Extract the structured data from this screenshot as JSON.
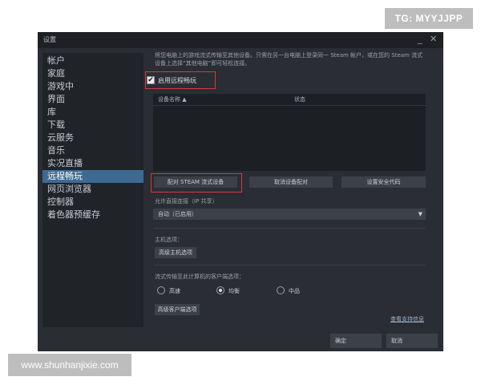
{
  "watermarks": {
    "top": "TG: MYYJJPP",
    "bottom": "www.shunhanjixie.com"
  },
  "window": {
    "title": "设置",
    "minimize": "_",
    "close": "✕"
  },
  "sidebar": {
    "items": [
      {
        "label": "帐户"
      },
      {
        "label": "家庭"
      },
      {
        "label": "游戏中"
      },
      {
        "label": "界面"
      },
      {
        "label": "库"
      },
      {
        "label": "下载"
      },
      {
        "label": "云服务"
      },
      {
        "label": "音乐"
      },
      {
        "label": "实况直播"
      },
      {
        "label": "远程畅玩"
      },
      {
        "label": "网页浏览器"
      },
      {
        "label": "控制器"
      },
      {
        "label": "着色器预缓存"
      }
    ],
    "active_index": 9
  },
  "panel": {
    "description": "将您电脑上的游戏流式传输至其他设备。只需在另一台电脑上登录同一 Steam 帐户，或在您的 Steam 流式设备上选择“其他电脑”即可轻松连接。",
    "enable_checkbox": {
      "label": "启用远程畅玩",
      "checked": true,
      "check_glyph": "✔"
    },
    "device_table": {
      "col_name": "设备名称 ▲",
      "col_status": "状态"
    },
    "buttons": {
      "pair_steam": "配对 STEAM 流式设备",
      "cancel_pair": "取消设备配对",
      "set_security": "设置安全代码"
    },
    "direct_connect": {
      "label": "允许直接连接（IP 共享）",
      "selected": "自动（已启用）",
      "arrow": "▼"
    },
    "host_options": {
      "label": "主机选项：",
      "button": "高级主机选项"
    },
    "client_options": {
      "label": "流式传输至此计算机的客户端选项：",
      "radios": [
        {
          "label": "高速",
          "selected": false
        },
        {
          "label": "均衡",
          "selected": true
        },
        {
          "label": "中品",
          "selected": false
        }
      ],
      "button": "高级客户端选项"
    },
    "support_link": "查看支持信息"
  },
  "footer": {
    "ok": "确定",
    "cancel": "取消"
  }
}
